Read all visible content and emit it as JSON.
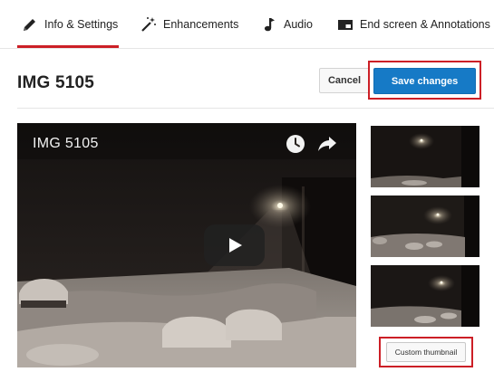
{
  "tabs": [
    {
      "label": "Info & Settings",
      "icon": "pencil-icon",
      "active": true
    },
    {
      "label": "Enhancements",
      "icon": "magic-wand-icon",
      "active": false
    },
    {
      "label": "Audio",
      "icon": "music-note-icon",
      "active": false
    },
    {
      "label": "End screen & Annotations",
      "icon": "end-screen-icon",
      "active": false
    }
  ],
  "header": {
    "title": "IMG 5105",
    "cancel_label": "Cancel",
    "save_label": "Save changes"
  },
  "player": {
    "title": "IMG 5105",
    "icons": [
      "clock-icon",
      "share-icon",
      "play-icon"
    ]
  },
  "thumbnails": {
    "custom_label": "Custom thumbnail"
  },
  "colors": {
    "accent_red": "#cc1f26",
    "save_blue": "#167ac6"
  }
}
